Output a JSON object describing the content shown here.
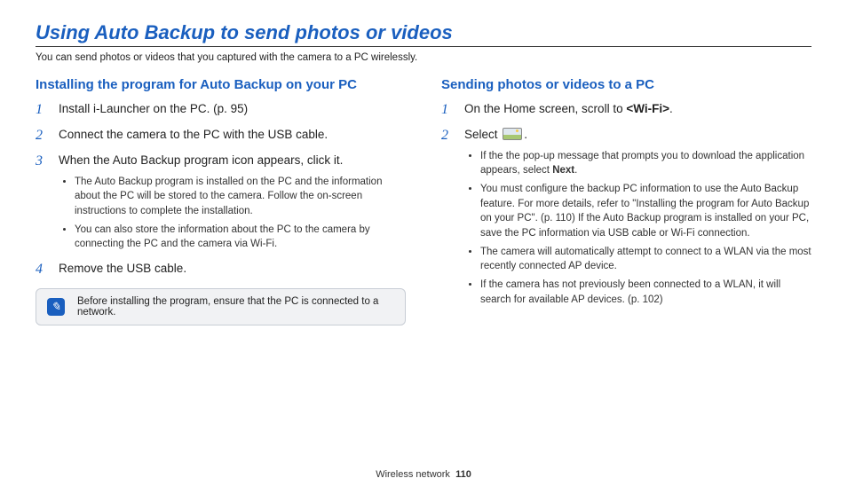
{
  "title": "Using Auto Backup to send photos or videos",
  "intro": "You can send photos or videos that you captured with the camera to a PC wirelessly.",
  "left": {
    "heading": "Installing the program for Auto Backup on your PC",
    "steps": [
      {
        "text": "Install i-Launcher on the PC. (p. 95)"
      },
      {
        "text": "Connect the camera to the PC with the USB cable."
      },
      {
        "text": "When the Auto Backup program icon appears, click it.",
        "sub": [
          "The Auto Backup program is installed on the PC and the information about the PC will be stored to the camera. Follow the on-screen instructions to complete the installation.",
          "You can also store the information about the PC to the camera by connecting the PC and the camera via Wi-Fi."
        ]
      },
      {
        "text": "Remove the USB cable."
      }
    ],
    "note": "Before installing the program, ensure that the PC is connected to a network."
  },
  "right": {
    "heading": "Sending photos or videos to a PC",
    "step1_pre": "On the Home screen, scroll to ",
    "step1_bold": "<Wi-Fi>",
    "step1_post": ".",
    "step2_pre": "Select ",
    "step2_post": ".",
    "sub": [
      {
        "pre": "If the the pop-up message that prompts you to download the application appears, select ",
        "bold": "Next",
        "post": "."
      },
      {
        "pre": "You must configure the backup PC information to use the Auto Backup feature. For more details, refer to \"Installing the program for Auto Backup on your PC\". (p. 110) If the Auto Backup program is installed on your PC, save the PC information via USB cable or Wi-Fi connection.",
        "bold": "",
        "post": ""
      },
      {
        "pre": "The camera will automatically attempt to connect to a WLAN via the most recently connected AP device.",
        "bold": "",
        "post": ""
      },
      {
        "pre": "If the camera has not previously been connected to a WLAN, it will search for available AP devices. (p. 102)",
        "bold": "",
        "post": ""
      }
    ]
  },
  "footer_section": "Wireless network",
  "footer_page": "110"
}
